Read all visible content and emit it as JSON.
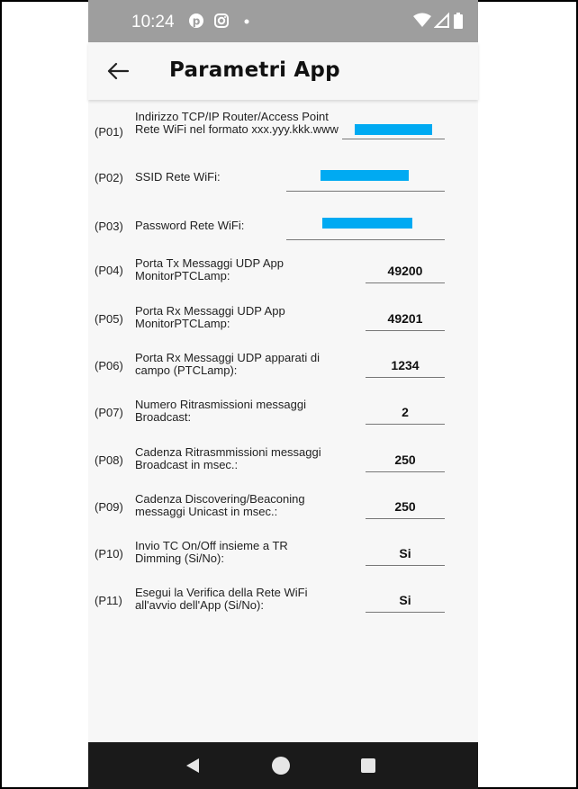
{
  "status_bar": {
    "time": "10:24",
    "icons": [
      "pinterest-icon",
      "instagram-icon",
      "dot-icon",
      "wifi-icon",
      "signal-icon",
      "battery-icon"
    ]
  },
  "app_bar": {
    "title": "Parametri App",
    "back_icon": "arrow-left-icon"
  },
  "params": [
    {
      "code": "(P01)",
      "label": "Indirizzo TCP/IP Router/Access Point Rete WiFi nel formato xxx.yyy.kkk.www",
      "value": "",
      "redacted": true
    },
    {
      "code": "(P02)",
      "label": "SSID Rete WiFi:",
      "value": "",
      "redacted": true
    },
    {
      "code": "(P03)",
      "label": "Password Rete WiFi:",
      "value": "",
      "redacted": true
    },
    {
      "code": "(P04)",
      "label": "Porta Tx Messaggi UDP App MonitorPTCLamp:",
      "value": "49200"
    },
    {
      "code": "(P05)",
      "label": "Porta Rx Messaggi UDP App MonitorPTCLamp:",
      "value": "49201"
    },
    {
      "code": "(P06)",
      "label": "Porta Rx Messaggi UDP apparati di campo (PTCLamp):",
      "value": "1234"
    },
    {
      "code": "(P07)",
      "label": "Numero Ritrasmissioni messaggi Broadcast:",
      "value": "2"
    },
    {
      "code": "(P08)",
      "label": "Cadenza Ritrasmmissioni messaggi Broadcast in msec.:",
      "value": "250"
    },
    {
      "code": "(P09)",
      "label": "Cadenza Discovering/Beaconing messaggi Unicast in msec.:",
      "value": "250"
    },
    {
      "code": "(P10)",
      "label": "Invio TC On/Off insieme a TR Dimming (Si/No):",
      "value": "Si"
    },
    {
      "code": "(P11)",
      "label": "Esegui la Verifica della Rete WiFi all'avvio dell'App (Si/No):",
      "value": "Si"
    }
  ],
  "colors": {
    "status_bar": "#9e9e9e",
    "background": "#f7f7f7",
    "nav_bar": "#1a1a1a",
    "redaction": "#00aaf2"
  },
  "nav_bar": {
    "icons": [
      "back-triangle-icon",
      "home-circle-icon",
      "recents-square-icon"
    ]
  }
}
